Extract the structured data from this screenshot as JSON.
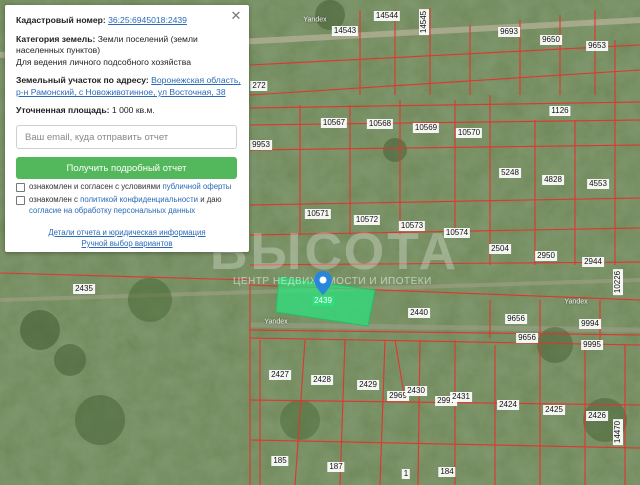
{
  "panel": {
    "cadastral_label": "Кадастровый номер:",
    "cadastral_number": "36:25:6945018:2439",
    "category_label": "Категория земель:",
    "category_value": "Земли поселений (земли",
    "category_value_2": "населенных пунктов)",
    "usage": "Для ведения личного подсобного хозяйства",
    "address_label": "Земельный участок по адресу:",
    "address_line1": "Воронежская область,",
    "address_line2": "р-н Рамонский, с Новоживотинное, ул Восточная, 38",
    "area_label": "Уточненная площадь:",
    "area_value": "1 000 кв.м.",
    "email_placeholder": "Ваш email, куда отправить отчет",
    "email_value": "",
    "button_label": "Получить подробный отчет",
    "consent1_text": "ознакомлен и согласен с условиями",
    "consent1_link": "публичной оферты",
    "consent2_text": "ознакомлен с",
    "consent2_link": "политикой конфиденциальности",
    "consent2_mid": "и даю",
    "consent2_link2": "согласие на обработку персональных данных",
    "details_link": "Детали отчета и юридическая информация",
    "manual_link": "Ручной выбор вариантов",
    "close_icon": "close-icon"
  },
  "map": {
    "watermark": "ВЫСОТА",
    "watermark_sub": "ЦЕНТР НЕДВИЖИМОСТИ И ИПОТЕКИ",
    "selected_plot": "2439",
    "marker_icon": "map-pin-icon",
    "road_labels": [
      "Yandex",
      "Yandex",
      "Yandex"
    ],
    "plot_labels": [
      "14543",
      "14544",
      "14545",
      "9693",
      "9650",
      "9653",
      "10567",
      "10568",
      "10569",
      "10570",
      "1126",
      "9953",
      "5248",
      "4828",
      "4553",
      "10571",
      "10572",
      "10573",
      "10574",
      "2504",
      "2950",
      "2944",
      "10226",
      "2435",
      "2440",
      "9656",
      "9994",
      "9656",
      "9995",
      "2427",
      "2428",
      "2429",
      "2969",
      "2430",
      "2997",
      "2431",
      "2424",
      "2425",
      "2426",
      "14470",
      "185",
      "187",
      "184",
      "1",
      "272"
    ],
    "colors": {
      "boundary": "#e3342f",
      "selected_fill": "#2ee07c",
      "accent": "#52b85b",
      "link": "#2a6ab8"
    }
  }
}
